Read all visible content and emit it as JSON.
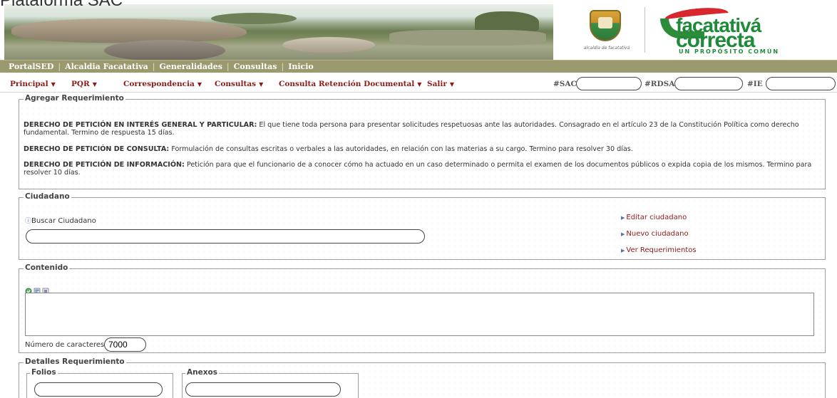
{
  "header": {
    "title_partial": "Plataforma SAC",
    "crest_caption": "alcaldía de facatativá",
    "logo_word1": "facatativá",
    "logo_word2": "correcta",
    "logo_tagline": "UN PROPÓSITO COMÚN"
  },
  "topnav": {
    "items": [
      "PortalSED",
      "Alcaldia Facatativa",
      "Generalidades",
      "Consultas",
      "Inicio"
    ],
    "separator": "|"
  },
  "menubar": {
    "items": [
      {
        "label": "Principal",
        "caret": "▼"
      },
      {
        "label": "PQR",
        "caret": "▼"
      },
      {
        "label": "Correspondencia",
        "caret": "▼"
      },
      {
        "label": "Consultas",
        "caret": "▼"
      },
      {
        "label": "Consulta Retención Documental",
        "caret": "▼"
      },
      {
        "label": "Salir",
        "caret": "▼"
      }
    ],
    "search": [
      {
        "label": "#SAC",
        "value": ""
      },
      {
        "label": "#RDSA",
        "value": ""
      },
      {
        "label": "#IE",
        "value": ""
      }
    ]
  },
  "agregar": {
    "legend": "Agregar Requerimiento",
    "paragraphs": [
      {
        "bold": "DERECHO DE PETICIÓN EN INTERÉS GENERAL Y PARTICULAR:",
        "text": " El que tiene toda persona para presentar solicitudes respetuosas ante las autoridades. Consagrado en el artículo 23 de la Constitución Política como derecho fundamental. Termino de respuesta 15 días."
      },
      {
        "bold": "DERECHO DE PETICIÓN DE CONSULTA:",
        "text": " Formulación de consultas escritas o verbales a las autoridades, en relación con las materias a su cargo. Termino para resolver 30 días."
      },
      {
        "bold": "DERECHO DE PETICIÓN DE INFORMACIÓN:",
        "text": " Petición para que el funcionario de a conocer cómo ha actuado en un caso determinado o permita el examen de los documentos públicos o expida copia de los mismos. Termino para resolver 10 días."
      }
    ]
  },
  "ciudadano": {
    "legend": "Ciudadano",
    "buscar_label": "Buscar Ciudadano",
    "buscar_value": "",
    "links": [
      "Editar ciudadano",
      "Nuevo ciudadano",
      "Ver Requerimientos"
    ]
  },
  "contenido": {
    "legend": "Contenido",
    "text_value": "",
    "char_label": "Número de caracteres:",
    "char_value": "7000"
  },
  "detalles": {
    "legend": "Detalles Requerimiento",
    "folios_legend": "Folios",
    "folios_value": "",
    "anexos_legend": "Anexos",
    "anexos_value": ""
  },
  "colors": {
    "nav_bar": "#9b9a6e",
    "menu_text": "#8b1a1a",
    "brand_green": "#1f8a3a",
    "brand_red": "#d7262e"
  }
}
